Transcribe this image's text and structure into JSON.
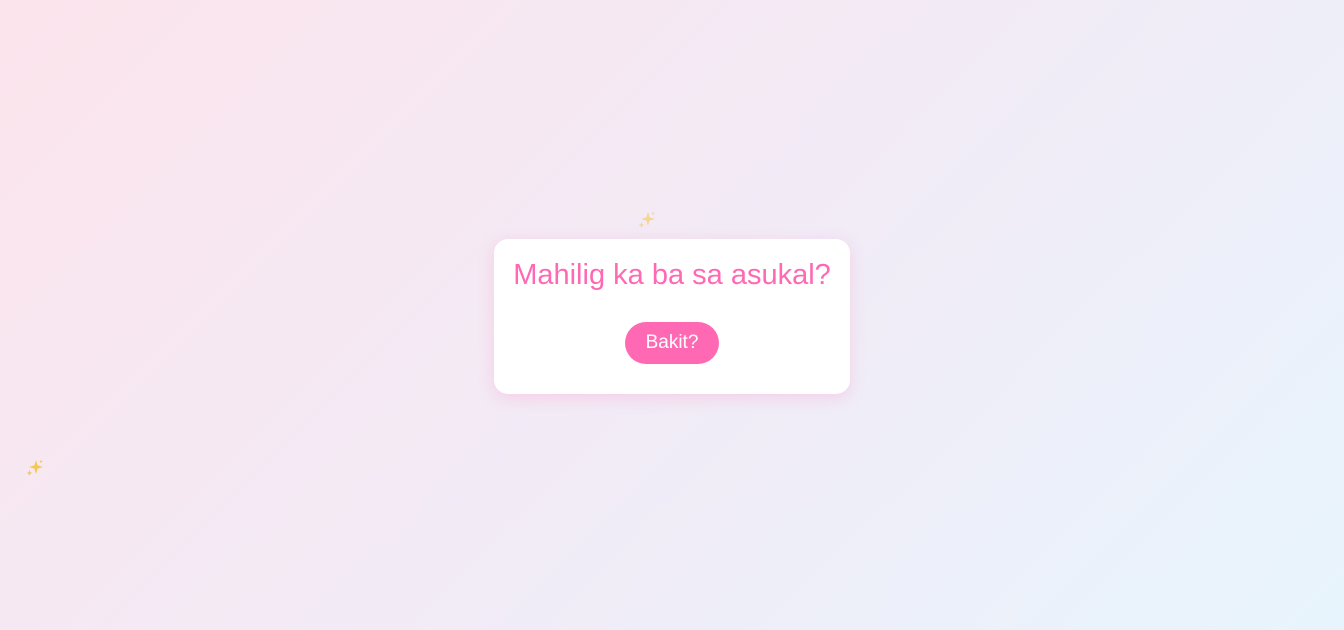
{
  "page": {
    "background_gradient": [
      "#fce4ec",
      "#f3eaf5",
      "#e8f4fd"
    ]
  },
  "card": {
    "title": "Mahilig ka ba sa asukal?",
    "button_label": "Bakit?"
  },
  "decorations": {
    "sparkle_icon": "sparkles-icon",
    "sparkle_color": "#f5c542",
    "sparkle_accent": "#ff69b4"
  },
  "colors": {
    "accent": "#ff69b4",
    "card_bg": "#ffffff",
    "button_text": "#ffffff"
  }
}
